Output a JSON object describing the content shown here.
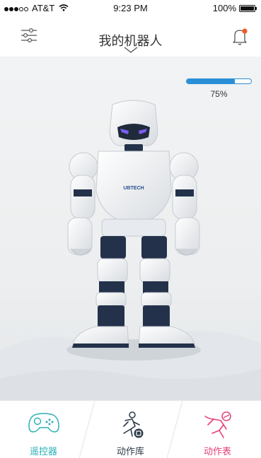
{
  "status_bar": {
    "carrier": "AT&T",
    "time": "9:23 PM",
    "battery_text": "100%",
    "battery_level": 1.0,
    "signal_bars_filled": 3,
    "signal_bars_total": 5
  },
  "nav": {
    "title": "我的机器人",
    "filter_icon": "sliders-icon",
    "dropdown_icon": "chevron-down-icon",
    "bell_icon": "bell-icon",
    "has_notification": true
  },
  "robot_battery": {
    "label": "75%",
    "level": 0.75,
    "color": "#2b8fd8"
  },
  "robot": {
    "brand": "UBTECH",
    "eye_color": "#7b5cf2"
  },
  "tabs": [
    {
      "label": "遥控器",
      "icon": "gamepad-icon",
      "color": "#2ab0b6"
    },
    {
      "label": "动作库",
      "icon": "action-library-icon",
      "color": "#2c3a4a"
    },
    {
      "label": "动作表",
      "icon": "action-table-icon",
      "color": "#e6407a"
    }
  ],
  "colors": {
    "accent_blue": "#2b8fd8",
    "notification_dot": "#f05a28",
    "remote_teal": "#2ab0b6",
    "action_table_pink": "#e6407a",
    "robot_dark": "#23324a"
  }
}
